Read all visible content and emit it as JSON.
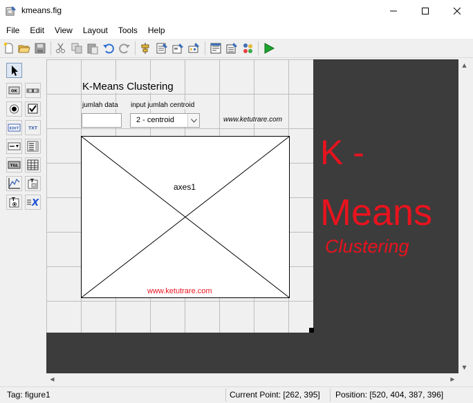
{
  "window": {
    "title": "kmeans.fig",
    "icon": "guide-figure-icon"
  },
  "menu": [
    "File",
    "Edit",
    "View",
    "Layout",
    "Tools",
    "Help"
  ],
  "toolbar": {
    "buttons": [
      "new-file-icon",
      "open-folder-icon",
      "save-icon",
      "cut-icon",
      "copy-icon",
      "paste-icon",
      "undo-icon",
      "redo-icon",
      "align-objects-icon",
      "menu-editor-icon",
      "tab-order-icon",
      "toolbar-editor-icon",
      "editor-icon",
      "property-inspector-icon",
      "object-browser-icon",
      "run-figure-icon"
    ]
  },
  "palette": {
    "items": [
      "select-arrow-icon",
      "push-button-icon",
      "slider-icon",
      "radio-button-icon",
      "checkbox-icon",
      "edit-text-icon",
      "static-text-icon",
      "popup-menu-icon",
      "listbox-icon",
      "toggle-button-icon",
      "table-icon",
      "axes-icon",
      "panel-icon",
      "button-group-icon",
      "activex-icon"
    ],
    "selected": "select-arrow-icon"
  },
  "figure": {
    "title": "K-Means Clustering",
    "label_data": "jumlah data",
    "label_centroid": "input jumlah centroid",
    "popup_value": "2 - centroid",
    "website_top": "www.ketutrare.com",
    "axes_label": "axes1",
    "axes_website": "www.ketutrare.com",
    "banner_k": "K -",
    "banner_means": "Means",
    "banner_clustering": "Clustering",
    "accent_color": "#e8131e"
  },
  "status": {
    "tag": "Tag: figure1",
    "current_point": "Current Point:  [262, 395]",
    "position": "Position: [520, 404, 387, 396]"
  }
}
